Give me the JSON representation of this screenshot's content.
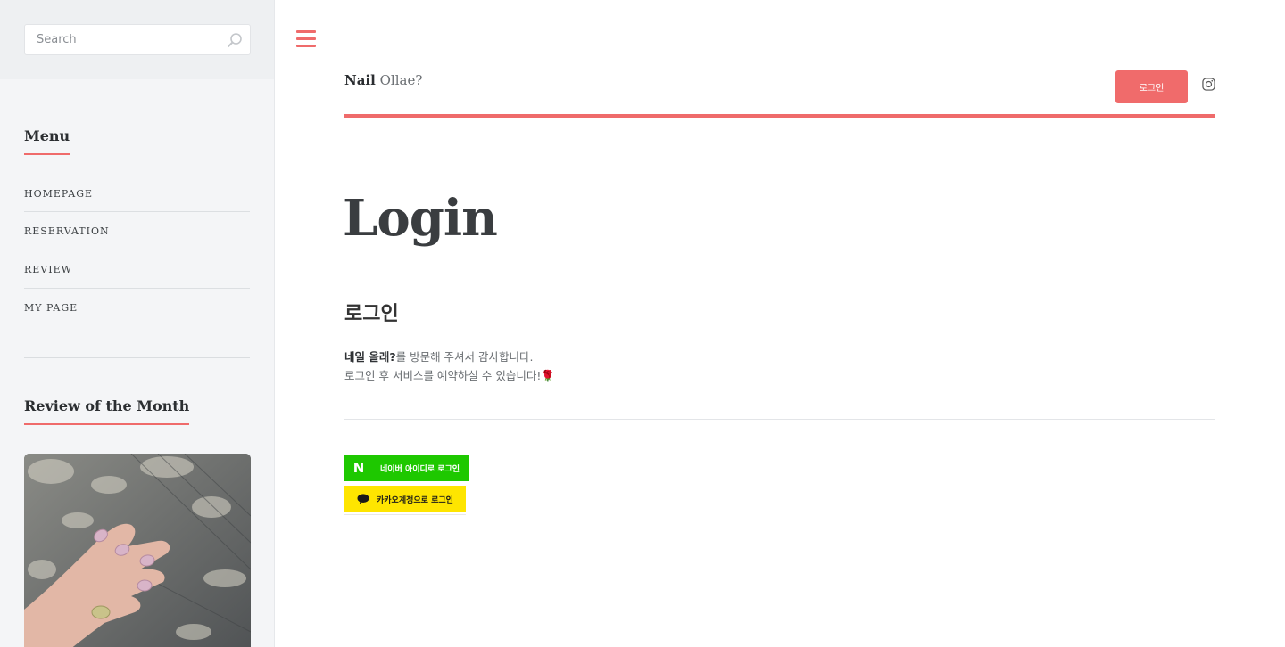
{
  "sidebar": {
    "search": {
      "placeholder": "Search"
    },
    "menu": {
      "title": "Menu",
      "items": [
        {
          "label": "HOMEPAGE"
        },
        {
          "label": "RESERVATION"
        },
        {
          "label": "REVIEW"
        },
        {
          "label": "MY PAGE"
        }
      ]
    },
    "review": {
      "title": "Review of the Month"
    }
  },
  "header": {
    "brand_bold": "Nail",
    "brand_rest": "Ollae?",
    "login_label": "로그인",
    "instagram_icon": "instagram-icon"
  },
  "main": {
    "title": "Login",
    "subheading": "로그인",
    "intro_bold": "네일 올래?",
    "intro_rest": "를 방문해 주셔서 감사합니다.",
    "intro_line2": "로그인 후 서비스를 예약하실 수 있습니다!",
    "intro_emoji": "🌹",
    "naver_label": "네이버 아이디로 로그인",
    "naver_letter": "N",
    "kakao_label": "카카오계정으로 로그인"
  },
  "colors": {
    "accent": "#ef6b6b",
    "naver": "#1ec800",
    "kakao": "#fee500",
    "sidebar_bg": "#f4f5f7"
  }
}
